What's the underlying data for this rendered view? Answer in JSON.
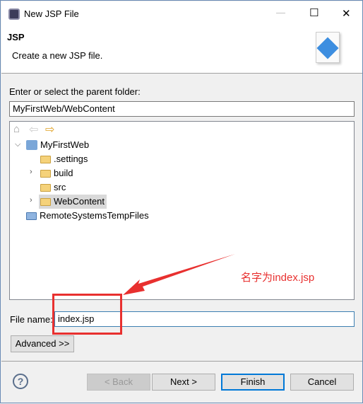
{
  "window": {
    "title": "New JSP File",
    "controls": {
      "minimize": "—",
      "maximize": "☐",
      "close": "✕"
    }
  },
  "header": {
    "title": "JSP",
    "description": "Create a new JSP file."
  },
  "folder": {
    "label": "Enter or select the parent folder:",
    "value": "MyFirstWeb/WebContent"
  },
  "tree": {
    "nav": {
      "home": "⌂",
      "back": "⇦",
      "forward": "⇨"
    },
    "items": [
      {
        "label": "MyFirstWeb",
        "expanded": true
      },
      {
        "label": ".settings"
      },
      {
        "label": "build",
        "collapsed": true
      },
      {
        "label": "src"
      },
      {
        "label": "WebContent",
        "collapsed": true,
        "selected": true
      },
      {
        "label": "RemoteSystemsTempFiles"
      }
    ]
  },
  "file": {
    "label": "File name:",
    "value": "index.jsp"
  },
  "advanced_label": "Advanced >>",
  "footer": {
    "help": "?",
    "back": "< Back",
    "next": "Next >",
    "finish": "Finish",
    "cancel": "Cancel"
  },
  "annotation": {
    "text": "名字为index.jsp",
    "color": "#e8302f"
  }
}
